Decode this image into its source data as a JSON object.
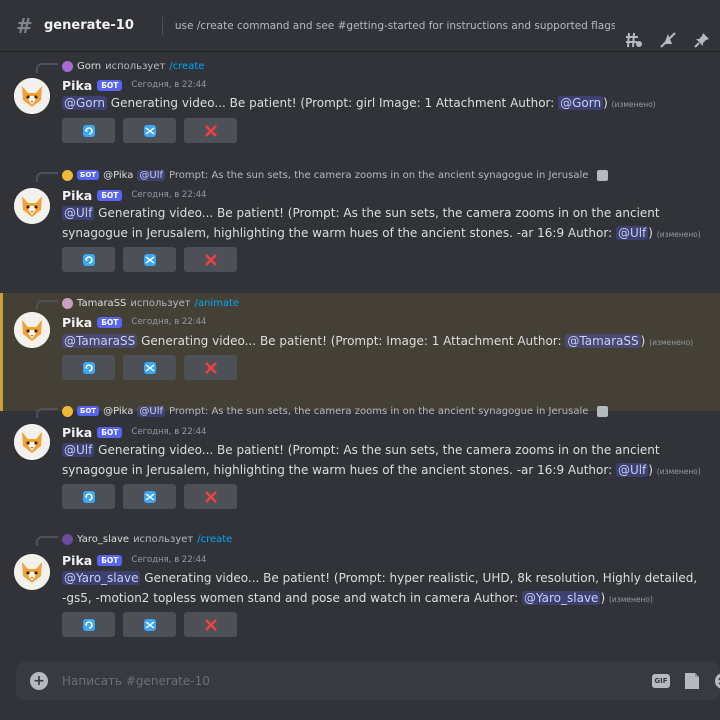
{
  "header": {
    "channel": "generate-10",
    "topic": "use /create command and see #getting-started for instructions and supported flags",
    "icons": [
      "threads-icon",
      "notifications-off-icon",
      "pin-icon"
    ]
  },
  "messages": [
    {
      "reply": {
        "user": "Gorn",
        "action": "использует",
        "command": "/create"
      },
      "author": "Pika",
      "bot_tag": "БОТ",
      "timestamp": "Сегодня, в 22:44",
      "mention": "@Gorn",
      "text": " Generating video... Be patient! (Prompt: girl  Image: 1 Attachment  Author: ",
      "author_mention": "@Gorn",
      "tail": ")",
      "edited": "(изменено)",
      "buttons": [
        "refresh-icon",
        "shuffle-icon",
        "close-icon"
      ]
    },
    {
      "reply": {
        "bot_tag": "БОТ",
        "user": "@Pika",
        "mention": "@Ulf",
        "text": " Prompt: As the sun sets, the camera zooms in on the ancient synagogue in Jerusalem, highlighting the wa"
      },
      "author": "Pika",
      "bot_tag": "БОТ",
      "timestamp": "Сегодня, в 22:44",
      "mention": "@Ulf",
      "text": " Generating video... Be patient! (Prompt: As the sun sets, the camera zooms in on the ancient synagogue in Jerusalem, highlighting the warm hues of the ancient stones. -ar 16:9  Author: ",
      "author_mention": "@Ulf",
      "tail": ")",
      "edited": "(изменено)",
      "buttons": [
        "refresh-icon",
        "shuffle-icon",
        "close-icon"
      ]
    },
    {
      "reply": {
        "user": "TamaraSS",
        "action": "использует",
        "command": "/animate"
      },
      "author": "Pika",
      "bot_tag": "БОТ",
      "timestamp": "Сегодня, в 22:44",
      "mention": "@TamaraSS",
      "text": " Generating video... Be patient! (Prompt:   Image: 1 Attachment  Author: ",
      "author_mention": "@TamaraSS",
      "tail": ")",
      "edited": "(изменено)",
      "buttons": [
        "refresh-icon",
        "shuffle-icon",
        "close-icon"
      ]
    },
    {
      "reply": {
        "bot_tag": "БОТ",
        "user": "@Pika",
        "mention": "@Ulf",
        "text": " Prompt: As the sun sets, the camera zooms in on the ancient synagogue in Jerusalem, highlighting the wa"
      },
      "author": "Pika",
      "bot_tag": "БОТ",
      "timestamp": "Сегодня, в 22:44",
      "mention": "@Ulf",
      "text": " Generating video... Be patient! (Prompt: As the sun sets, the camera zooms in on the ancient synagogue in Jerusalem, highlighting the warm hues of the ancient stones. -ar 16:9  Author: ",
      "author_mention": "@Ulf",
      "tail": ")",
      "edited": "(изменено)",
      "buttons": [
        "refresh-icon",
        "shuffle-icon",
        "close-icon"
      ]
    },
    {
      "reply": {
        "user": "Yaro_slave",
        "action": "использует",
        "command": "/create"
      },
      "author": "Pika",
      "bot_tag": "БОТ",
      "timestamp": "Сегодня, в 22:44",
      "mention": "@Yaro_slave",
      "text": " Generating video... Be patient! (Prompt: hyper realistic, UHD, 8k resolution, Highly detailed, -gs5, -motion2 topless women stand and pose and watch in camera  Author: ",
      "author_mention": "@Yaro_slave",
      "tail": ")",
      "edited": "(изменено)",
      "buttons": [
        "refresh-icon",
        "shuffle-icon",
        "close-icon"
      ]
    }
  ],
  "composer": {
    "placeholder": "Написать #generate-10",
    "gif_label": "GIF"
  },
  "colors": {
    "background": "#313338",
    "mention": "#c9cdfb",
    "command_link": "#00a8fc",
    "highlight": "#444036",
    "button_red": "#f23f43",
    "bot_tag": "#5865f2"
  }
}
